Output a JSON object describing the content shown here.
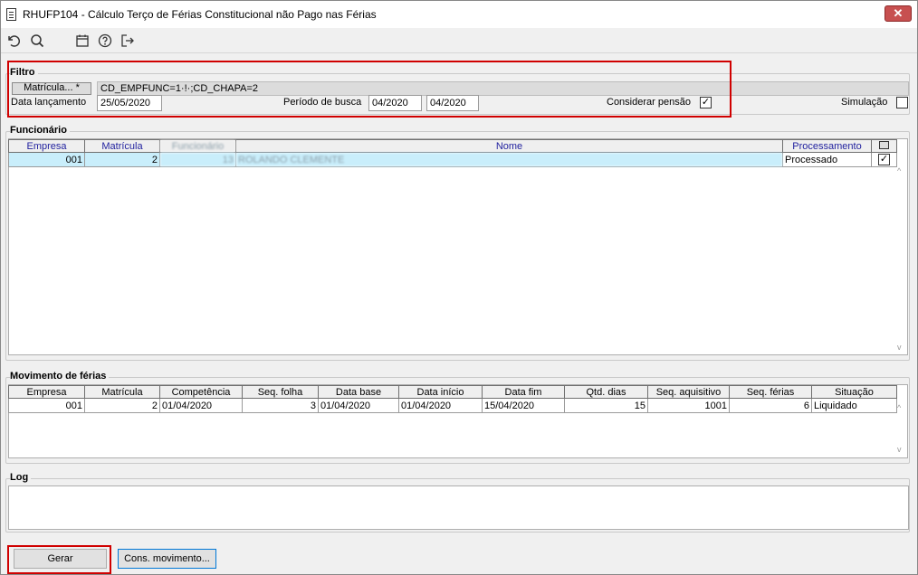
{
  "window": {
    "title": "RHUFP104 - Cálculo Terço de Férias Constitucional não Pago nas Férias",
    "close_label": "✕"
  },
  "toolbar": {
    "icons": [
      "undo-icon",
      "search-icon",
      "calendar-icon",
      "help-icon",
      "exit-icon"
    ]
  },
  "filtro": {
    "legend": "Filtro",
    "matricula_label": "Matrícula... *",
    "matricula_value": "CD_EMPFUNC=1·!·;CD_CHAPA=2",
    "data_lancamento_label": "Data lançamento",
    "data_lancamento_value": "25/05/2020",
    "periodo_label": "Período de busca",
    "periodo_inicio": "04/2020",
    "periodo_fim": "04/2020",
    "considerar_pensao_label": "Considerar pensão",
    "considerar_pensao_checked": "✓",
    "simulacao_label": "Simulação",
    "simulacao_checked": ""
  },
  "funcionario": {
    "legend": "Funcionário",
    "columns": {
      "empresa": "Empresa",
      "matricula": "Matrícula",
      "funcionario": "Funcionário",
      "nome": "Nome",
      "processamento": "Processamento"
    },
    "rows": [
      {
        "empresa": "001",
        "matricula": "2",
        "funcionario": "13",
        "nome": "ROLANDO CLEMENTE",
        "processamento": "Processado",
        "checked": "✓"
      }
    ]
  },
  "movimento": {
    "legend": "Movimento de férias",
    "columns": {
      "empresa": "Empresa",
      "matricula": "Matrícula",
      "competencia": "Competência",
      "seq_folha": "Seq. folha",
      "data_base": "Data base",
      "data_inicio": "Data início",
      "data_fim": "Data fim",
      "qtd_dias": "Qtd. dias",
      "seq_aquisitivo": "Seq. aquisitivo",
      "seq_ferias": "Seq. férias",
      "situacao": "Situação"
    },
    "rows": [
      {
        "empresa": "001",
        "matricula": "2",
        "competencia": "01/04/2020",
        "seq_folha": "3",
        "data_base": "01/04/2020",
        "data_inicio": "01/04/2020",
        "data_fim": "15/04/2020",
        "qtd_dias": "15",
        "seq_aquisitivo": "1001",
        "seq_ferias": "6",
        "situacao": "Liquidado"
      }
    ]
  },
  "log": {
    "legend": "Log",
    "content": ""
  },
  "buttons": {
    "gerar": "Gerar",
    "cons_movimento": "Cons. movimento..."
  },
  "colors": {
    "highlight_red": "#d00000",
    "selected_row": "#c9eefb",
    "header_blue": "#1f1f9e"
  }
}
